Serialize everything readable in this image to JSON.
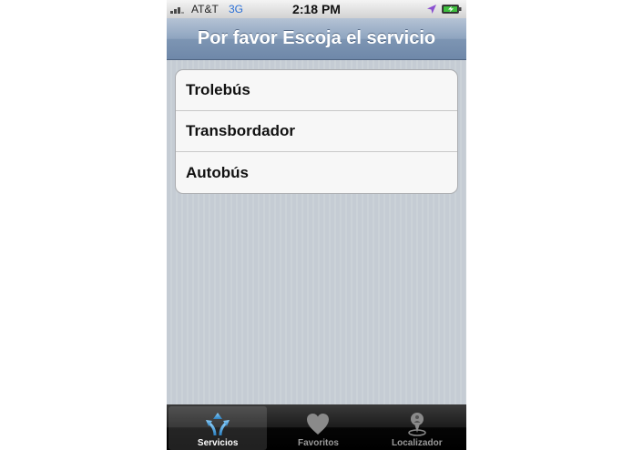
{
  "status_bar": {
    "carrier": "AT&T",
    "network": "3G",
    "time": "2:18 PM"
  },
  "nav": {
    "title": "Por favor Escoja el servicio"
  },
  "services": [
    {
      "label": "Trolebús"
    },
    {
      "label": "Transbordador"
    },
    {
      "label": "Autobús"
    }
  ],
  "tabs": [
    {
      "label": "Servicios",
      "icon": "services-arrows-icon",
      "selected": true
    },
    {
      "label": "Favoritos",
      "icon": "heart-icon",
      "selected": false
    },
    {
      "label": "Localizador",
      "icon": "location-pin-person-icon",
      "selected": false
    }
  ],
  "colors": {
    "nav_bar": "#8ea4bf",
    "selected_tab_icon": "#4aa0d8",
    "network_text": "#2a6fd6"
  }
}
